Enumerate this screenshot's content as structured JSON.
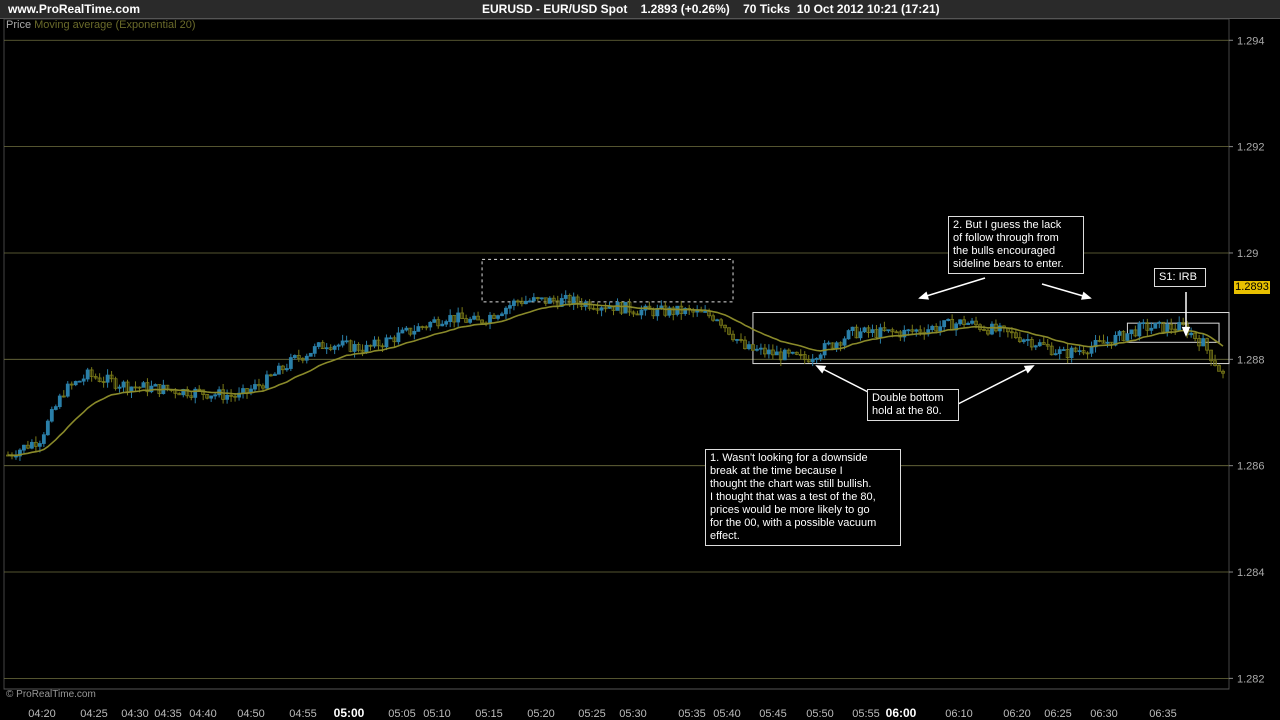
{
  "header": {
    "site": "www.ProRealTime.com",
    "title": "EURUSD - EUR/USD Spot    1.2893 (+0.26%)    70 Ticks  10 Oct 2012 10:21 (17:21)"
  },
  "caption": {
    "series": "Price",
    "indicator": "Moving average (Exponential 20)"
  },
  "footer": "© ProRealTime.com",
  "current_price": "1.2893",
  "annotations": {
    "note1": "1. Wasn't looking for a downside\nbreak at the time because I\nthought the chart was still bullish.\nI thought that was a test of the 80,\nprices would be more likely to go\nfor the 00, with a possible vacuum\neffect.",
    "note2": "2. But I guess the lack\nof follow through from\nthe bulls encouraged\nsideline bears to enter.",
    "note3": "Double bottom\nhold at the 80.",
    "note4": "S1: IRB"
  },
  "colors": {
    "up_candle": "#2a7fa8",
    "down_candle": "#7a7a18",
    "moving_average": "#8a8a2a",
    "gridline": "#707040",
    "price_highlight": "#e8c000"
  },
  "chart_data": {
    "type": "candlestick",
    "y_axis": {
      "range": [
        1.2818,
        1.2944
      ],
      "ticks": [
        "1.294",
        "1.292",
        "1.29",
        "1.288",
        "1.286",
        "1.284",
        "1.282"
      ],
      "grid": true
    },
    "x_axis": {
      "ticks": [
        "04:20",
        "04:25",
        "04:30",
        "04:35",
        "04:40",
        "04:50",
        "04:55",
        "05:00",
        "05:05",
        "05:10",
        "05:15",
        "05:20",
        "05:25",
        "05:30",
        "05:35",
        "05:40",
        "05:45",
        "05:50",
        "05:55",
        "06:00",
        "06:10",
        "06:20",
        "06:25",
        "06:30",
        "06:35"
      ],
      "bold_ticks": [
        "05:00",
        "06:00"
      ]
    },
    "price_path": [
      {
        "i": 0,
        "p": 1.2862
      },
      {
        "i": 8,
        "p": 1.2865
      },
      {
        "i": 14,
        "p": 1.2874
      },
      {
        "i": 20,
        "p": 1.2877
      },
      {
        "i": 30,
        "p": 1.2875
      },
      {
        "i": 45,
        "p": 1.2874
      },
      {
        "i": 58,
        "p": 1.2873
      },
      {
        "i": 65,
        "p": 1.2876
      },
      {
        "i": 72,
        "p": 1.288
      },
      {
        "i": 80,
        "p": 1.2883
      },
      {
        "i": 90,
        "p": 1.2882
      },
      {
        "i": 100,
        "p": 1.2885
      },
      {
        "i": 110,
        "p": 1.2888
      },
      {
        "i": 118,
        "p": 1.2887
      },
      {
        "i": 128,
        "p": 1.2891
      },
      {
        "i": 140,
        "p": 1.2891
      },
      {
        "i": 152,
        "p": 1.289
      },
      {
        "i": 160,
        "p": 1.2889
      },
      {
        "i": 170,
        "p": 1.2889
      },
      {
        "i": 178,
        "p": 1.2888
      },
      {
        "i": 185,
        "p": 1.2882
      },
      {
        "i": 200,
        "p": 1.288
      },
      {
        "i": 212,
        "p": 1.2885
      },
      {
        "i": 225,
        "p": 1.2885
      },
      {
        "i": 240,
        "p": 1.2887
      },
      {
        "i": 255,
        "p": 1.2884
      },
      {
        "i": 265,
        "p": 1.2881
      },
      {
        "i": 275,
        "p": 1.2883
      },
      {
        "i": 285,
        "p": 1.2886
      },
      {
        "i": 295,
        "p": 1.2886
      },
      {
        "i": 300,
        "p": 1.2883
      },
      {
        "i": 305,
        "p": 1.2877
      }
    ],
    "candle_count": 306,
    "boxes": [
      {
        "from_i": 119,
        "to_i": 182,
        "high": 1.28988,
        "low": 1.28908,
        "style": "dashed"
      },
      {
        "from_i": 187,
        "to_i": 307,
        "high": 1.28888,
        "low": 1.28792,
        "style": "solid"
      },
      {
        "from_i": 281,
        "to_i": 304,
        "high": 1.28868,
        "low": 1.28832,
        "style": "solid"
      }
    ]
  }
}
